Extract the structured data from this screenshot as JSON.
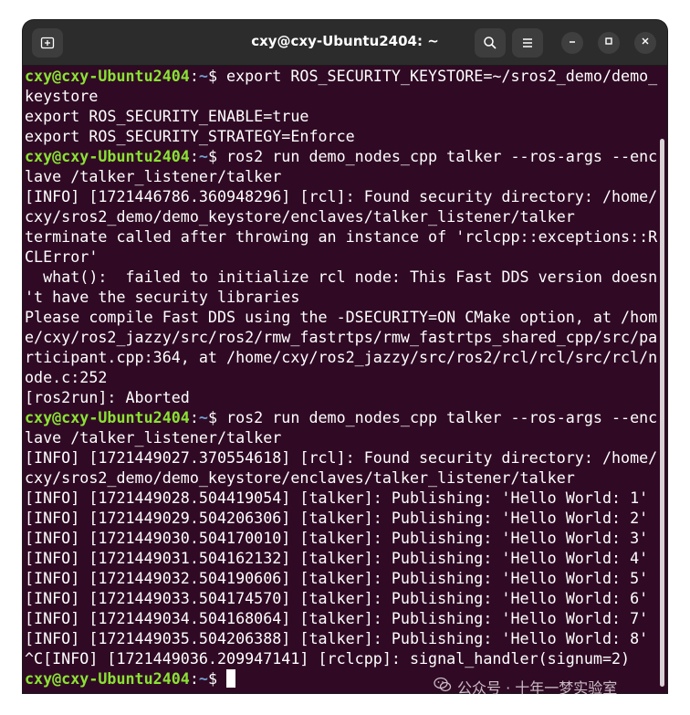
{
  "window": {
    "title": "cxy@cxy-Ubuntu2404: ~"
  },
  "titlebar": {
    "new_tab_icon": "new-tab-icon",
    "search_icon": "search-icon",
    "menu_icon": "hamburger-menu-icon",
    "minimize_icon": "minimize-icon",
    "maximize_icon": "maximize-icon",
    "close_icon": "close-icon"
  },
  "colors": {
    "terminal_bg": "#300a24",
    "prompt_user": "#8ae234",
    "prompt_path": "#729fcf",
    "titlebar_bg": "#2c2c2c"
  },
  "terminal": {
    "prompt_user": "cxy@cxy-Ubuntu2404",
    "prompt_sep": ":",
    "prompt_path": "~",
    "prompt_end": "$ ",
    "lines": [
      {
        "type": "prompt",
        "text": "export ROS_SECURITY_KEYSTORE=~/sros2_demo/demo_"
      },
      {
        "type": "output",
        "text": "keystore"
      },
      {
        "type": "output",
        "text": "export ROS_SECURITY_ENABLE=true"
      },
      {
        "type": "output",
        "text": "export ROS_SECURITY_STRATEGY=Enforce"
      },
      {
        "type": "prompt",
        "text": "ros2 run demo_nodes_cpp talker --ros-args --enc"
      },
      {
        "type": "output",
        "text": "lave /talker_listener/talker"
      },
      {
        "type": "output",
        "text": "[INFO] [1721446786.360948296] [rcl]: Found security directory: /home/"
      },
      {
        "type": "output",
        "text": "cxy/sros2_demo/demo_keystore/enclaves/talker_listener/talker"
      },
      {
        "type": "output",
        "text": "terminate called after throwing an instance of 'rclcpp::exceptions::R"
      },
      {
        "type": "output",
        "text": "CLError'"
      },
      {
        "type": "output",
        "text": "  what():  failed to initialize rcl node: This Fast DDS version doesn"
      },
      {
        "type": "output",
        "text": "'t have the security libraries"
      },
      {
        "type": "output",
        "text": "Please compile Fast DDS using the -DSECURITY=ON CMake option, at /hom"
      },
      {
        "type": "output",
        "text": "e/cxy/ros2_jazzy/src/ros2/rmw_fastrtps/rmw_fastrtps_shared_cpp/src/pa"
      },
      {
        "type": "output",
        "text": "rticipant.cpp:364, at /home/cxy/ros2_jazzy/src/ros2/rcl/rcl/src/rcl/n"
      },
      {
        "type": "output",
        "text": "ode.c:252"
      },
      {
        "type": "output",
        "text": "[ros2run]: Aborted"
      },
      {
        "type": "prompt",
        "text": "ros2 run demo_nodes_cpp talker --ros-args --enc"
      },
      {
        "type": "output",
        "text": "lave /talker_listener/talker"
      },
      {
        "type": "output",
        "text": "[INFO] [1721449027.370554618] [rcl]: Found security directory: /home/"
      },
      {
        "type": "output",
        "text": "cxy/sros2_demo/demo_keystore/enclaves/talker_listener/talker"
      },
      {
        "type": "output",
        "text": "[INFO] [1721449028.504419054] [talker]: Publishing: 'Hello World: 1'"
      },
      {
        "type": "output",
        "text": "[INFO] [1721449029.504206306] [talker]: Publishing: 'Hello World: 2'"
      },
      {
        "type": "output",
        "text": "[INFO] [1721449030.504170010] [talker]: Publishing: 'Hello World: 3'"
      },
      {
        "type": "output",
        "text": "[INFO] [1721449031.504162132] [talker]: Publishing: 'Hello World: 4'"
      },
      {
        "type": "output",
        "text": "[INFO] [1721449032.504190606] [talker]: Publishing: 'Hello World: 5'"
      },
      {
        "type": "output",
        "text": "[INFO] [1721449033.504174570] [talker]: Publishing: 'Hello World: 6'"
      },
      {
        "type": "output",
        "text": "[INFO] [1721449034.504168064] [talker]: Publishing: 'Hello World: 7'"
      },
      {
        "type": "output",
        "text": "[INFO] [1721449035.504206388] [talker]: Publishing: 'Hello World: 8'"
      },
      {
        "type": "output",
        "text": "^C[INFO] [1721449036.209947141] [rclcpp]: signal_handler(signum=2)"
      },
      {
        "type": "prompt_cursor",
        "text": ""
      }
    ]
  },
  "watermark": {
    "icon": "wechat-icon",
    "text": "公众号 · 十年一梦实验室"
  }
}
